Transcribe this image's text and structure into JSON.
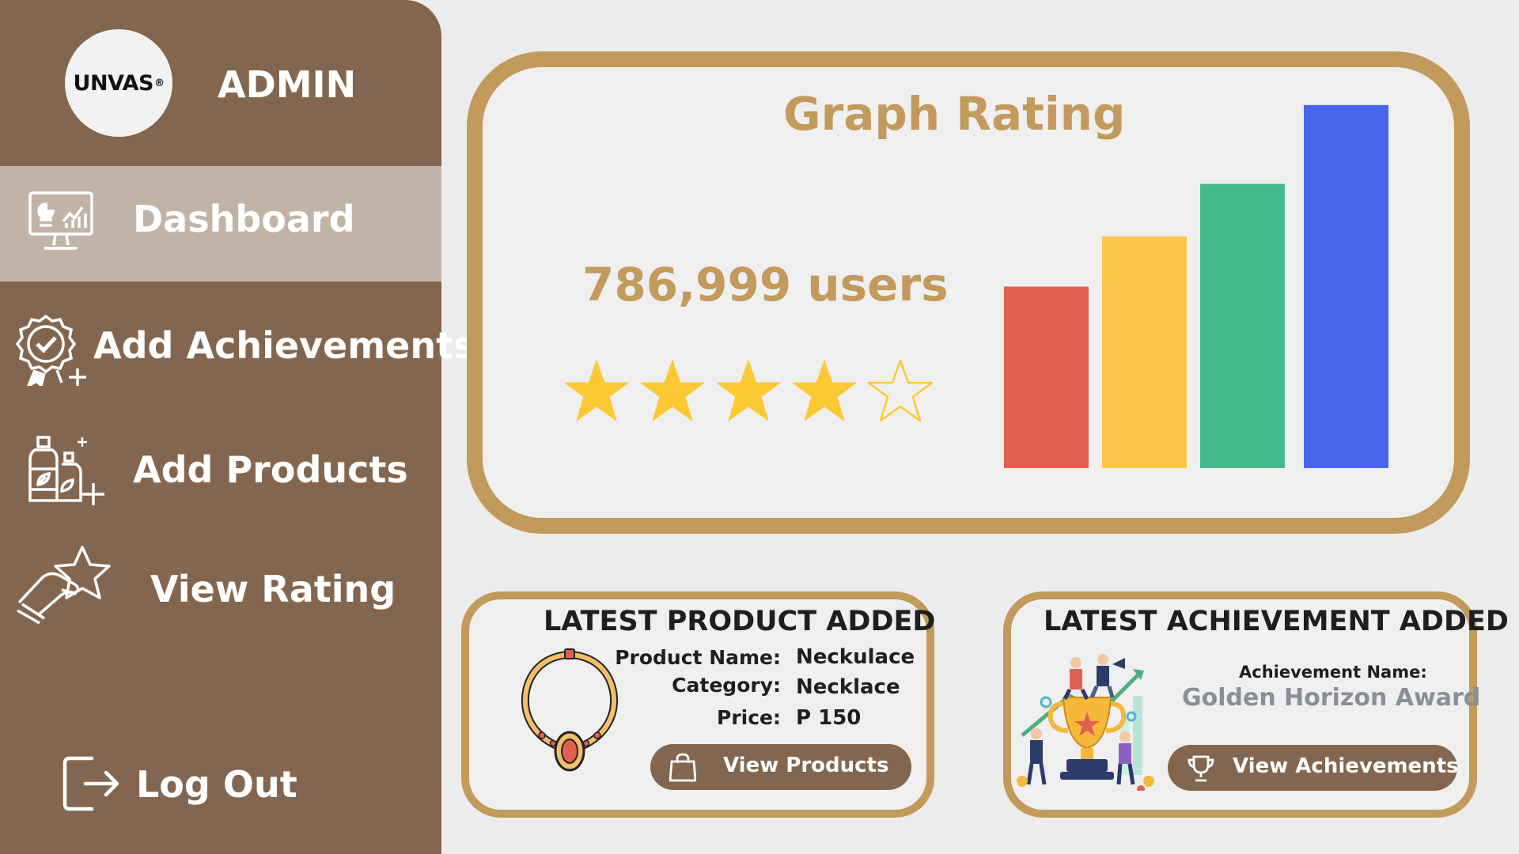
{
  "sidebar": {
    "logo_text": "UNVAS",
    "logo_mark": "®",
    "role": "ADMIN",
    "items": [
      {
        "label": "Dashboard",
        "icon": "dashboard-monitor-icon",
        "active": true
      },
      {
        "label": "Add Achievements",
        "icon": "award-badge-plus-icon"
      },
      {
        "label": "Add Products",
        "icon": "product-bottles-plus-icon"
      },
      {
        "label": "View Rating",
        "icon": "hand-star-icon"
      }
    ],
    "logout_label": "Log Out"
  },
  "rating": {
    "title": "Graph Rating",
    "users": "786,999 users",
    "stars_filled": 4,
    "stars_total": 5,
    "star_color": "#fcc934"
  },
  "chart_data": {
    "type": "bar",
    "categories": [
      "",
      "",
      "",
      ""
    ],
    "values": [
      145,
      185,
      227,
      290
    ],
    "colors": [
      "#e06150",
      "#fac548",
      "#43b98c",
      "#4866ec"
    ],
    "ylim": [
      0,
      300
    ],
    "title": "",
    "xlabel": "",
    "ylabel": "",
    "grid": false,
    "axes_visible": false
  },
  "latest_product": {
    "title": "LATEST PRODUCT ADDED",
    "name_label": "Product Name:",
    "name_value": "Neckulace",
    "category_label": "Category:",
    "category_value": "Necklace",
    "price_label": "Price:",
    "price_value": "P 150",
    "button_label": "View Products",
    "image": "necklace-illustration"
  },
  "latest_achievement": {
    "title": "LATEST ACHIEVEMENT ADDED",
    "name_label": "Achievement Name:",
    "name_value": "Golden Horizon Award",
    "button_label": "View Achievements",
    "image": "trophy-team-illustration"
  },
  "colors": {
    "sidebar": "#82664f",
    "active_item": "#c1b4a7",
    "accent_gold": "#c29a5c",
    "background": "#ececec"
  }
}
